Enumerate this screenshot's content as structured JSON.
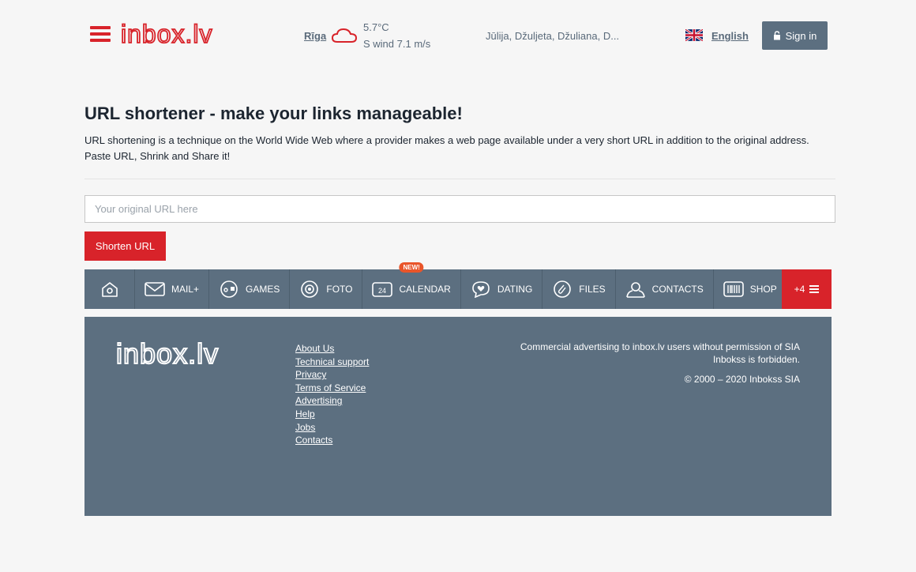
{
  "header": {
    "logo_text": "inbox.lv",
    "weather": {
      "city": "Rīga",
      "temperature": "5.7°C",
      "wind": "S wind 7.1 m/s"
    },
    "namedays": "Jūlija, Džuljeta, Džuliana, D...",
    "language": "English",
    "signin_label": "Sign in"
  },
  "main": {
    "title": "URL shortener - make your links manageable!",
    "description": "URL shortening is a technique on the World Wide Web where a provider makes a web page available under a very short URL in addition to the original address. Paste URL, Shrink and Share it!",
    "url_input": {
      "value": "",
      "placeholder": "Your original URL here"
    },
    "shorten_label": "Shorten URL"
  },
  "nav": {
    "items": [
      {
        "label": "MAIL+",
        "icon": "mail-icon"
      },
      {
        "label": "GAMES",
        "icon": "games-icon"
      },
      {
        "label": "FOTO",
        "icon": "camera-icon"
      },
      {
        "label": "CALENDAR",
        "icon": "calendar-icon",
        "badge": "NEW!"
      },
      {
        "label": "DATING",
        "icon": "heart-chat-icon"
      },
      {
        "label": "FILES",
        "icon": "paperclip-icon"
      },
      {
        "label": "CONTACTS",
        "icon": "contacts-icon"
      },
      {
        "label": "SHOP",
        "icon": "barcode-icon"
      }
    ],
    "more_label": "+4"
  },
  "footer": {
    "logo_text": "inbox.lv",
    "links": [
      "About Us",
      "Technical support",
      "Privacy",
      "Terms of Service",
      "Advertising",
      "Help",
      "Jobs",
      "Contacts"
    ],
    "legal": "Commercial advertising to inbox.lv users without permission of SIA Inbokss is forbidden.",
    "copyright": "© 2000 – 2020 Inbokss SIA"
  },
  "colors": {
    "brand_red": "#d8232a",
    "slate": "#5c6f80",
    "text_muted": "#5a6a7a"
  }
}
